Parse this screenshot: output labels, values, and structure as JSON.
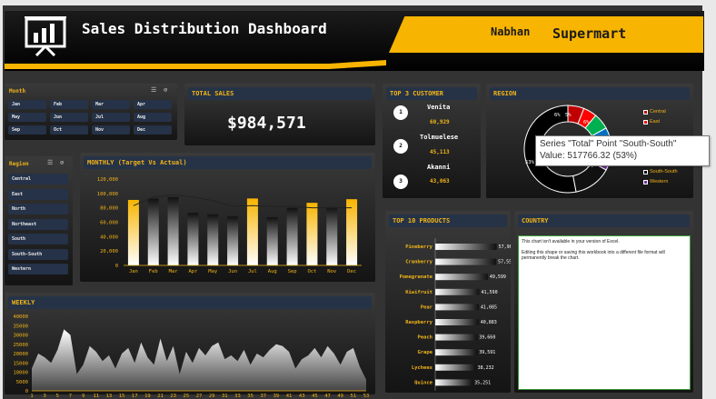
{
  "header": {
    "title": "Sales Distribution Dashboard",
    "company_a": "Nabhan",
    "company_b": "Supermart"
  },
  "month_slicer": {
    "title": "Month",
    "items": [
      "Jan",
      "Feb",
      "Mar",
      "Apr",
      "May",
      "Jun",
      "Jul",
      "Aug",
      "Sep",
      "Oct",
      "Nov",
      "Dec"
    ]
  },
  "region_slicer": {
    "title": "Region",
    "items": [
      "Central",
      "East",
      "North",
      "Northeast",
      "South",
      "South-South",
      "Western"
    ]
  },
  "total_sales": {
    "title": "TOTAL SALES",
    "value": "$984,571"
  },
  "top_customers": {
    "title": "TOP 3 CUSTOMER",
    "items": [
      {
        "rank": "1",
        "name": "Venita",
        "value": "60,929"
      },
      {
        "rank": "2",
        "name": "Tolmuelese",
        "value": "45,113"
      },
      {
        "rank": "3",
        "name": "Akanni",
        "value": "43,063"
      }
    ]
  },
  "region_panel": {
    "title": "REGION",
    "slice_labels": [
      "6%",
      "5%",
      "6%",
      "8%",
      "53%"
    ],
    "legend": [
      "Central",
      "East",
      "South-South",
      "Western"
    ]
  },
  "tooltip": {
    "line1": "Series \"Total\" Point \"South-South\"",
    "line2": "Value: 517766.32 (53%)"
  },
  "country_panel": {
    "title": "COUNTRY",
    "msg1": "This chart isn't available in your version of Excel.",
    "msg2": "Editing this shape or saving this workbook into a different file format will permanently break the chart."
  },
  "colors": {
    "accent": "#f7b400",
    "panel_title_bg": "#263347"
  },
  "chart_data": [
    {
      "type": "bar",
      "title": "MONTHLY (Target Vs Actual)",
      "categories": [
        "Jan",
        "Feb",
        "Mar",
        "Apr",
        "May",
        "Jun",
        "Jul",
        "Aug",
        "Sep",
        "Oct",
        "Nov",
        "Dec"
      ],
      "series": [
        {
          "values": [
            91000,
            93000,
            95000,
            73000,
            71000,
            68000,
            93000,
            67000,
            80000,
            87000,
            81000,
            92000
          ]
        },
        {
          "values": [
            83000,
            95000,
            98000,
            95000,
            90000,
            82000,
            83000,
            82000,
            82000,
            80000,
            80000,
            80000
          ]
        }
      ],
      "yticks": [
        "0",
        "20,000",
        "40,000",
        "60,000",
        "80,000",
        "100,000",
        "120,000"
      ],
      "ylim": [
        0,
        120000
      ]
    },
    {
      "type": "bar",
      "title": "TOP 10 PRODUCTS",
      "categories": [
        "Pineberry",
        "Cranberry",
        "Pomegranate",
        "Kiwifruit",
        "Pear",
        "Raspberry",
        "Peach",
        "Grape",
        "Lychees",
        "Quince"
      ],
      "values": [
        57963,
        57554,
        49599,
        41590,
        41085,
        40883,
        39660,
        39591,
        38232,
        35251
      ],
      "value_labels": [
        "57,963",
        "57,554",
        "49,599",
        "41,590",
        "41,085",
        "40,883",
        "39,660",
        "39,591",
        "38,232",
        "35,251"
      ]
    },
    {
      "type": "area",
      "title": "WEEKLY",
      "x": [
        1,
        2,
        3,
        4,
        5,
        6,
        7,
        8,
        9,
        10,
        11,
        12,
        13,
        14,
        15,
        16,
        17,
        18,
        19,
        20,
        21,
        22,
        23,
        24,
        25,
        26,
        27,
        28,
        29,
        30,
        31,
        32,
        33,
        34,
        35,
        36,
        37,
        38,
        39,
        40,
        41,
        42,
        43,
        44,
        45,
        46,
        47,
        48,
        49,
        50,
        51,
        52,
        53
      ],
      "xticks": [
        "1",
        "3",
        "5",
        "7",
        "9",
        "11",
        "13",
        "15",
        "17",
        "19",
        "21",
        "23",
        "25",
        "27",
        "29",
        "31",
        "33",
        "35",
        "37",
        "39",
        "41",
        "43",
        "45",
        "47",
        "49",
        "51",
        "53"
      ],
      "values": [
        12000,
        20000,
        18000,
        15000,
        22000,
        33000,
        30000,
        9000,
        14000,
        24000,
        21000,
        16000,
        19000,
        12000,
        20000,
        23000,
        15000,
        26000,
        18000,
        14000,
        28000,
        16000,
        24000,
        9000,
        21000,
        15000,
        23000,
        19000,
        24000,
        26000,
        17000,
        19000,
        16000,
        22000,
        14000,
        20000,
        18000,
        22000,
        25000,
        24000,
        21000,
        12000,
        17000,
        19000,
        23000,
        18000,
        24000,
        20000,
        14000,
        21000,
        23000,
        13000,
        6000
      ],
      "yticks": [
        "0",
        "5000",
        "10000",
        "15000",
        "20000",
        "25000",
        "30000",
        "35000",
        "40000"
      ],
      "ylim": [
        0,
        40000
      ]
    },
    {
      "type": "pie",
      "title": "REGION",
      "categories": [
        "Central",
        "East",
        "North",
        "Northeast",
        "South",
        "Western",
        "South-South"
      ],
      "values": [
        6,
        5,
        6,
        8,
        8,
        14,
        53
      ]
    }
  ]
}
